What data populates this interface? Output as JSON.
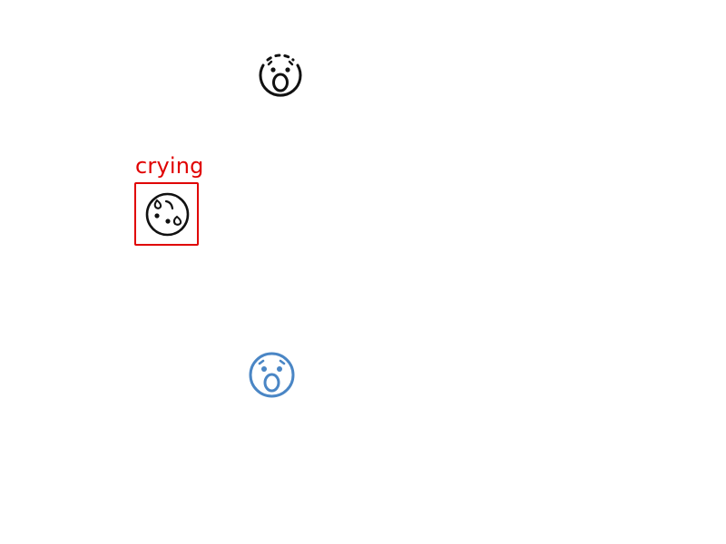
{
  "highlight": {
    "label": "crying",
    "color": "#e00000"
  },
  "icons": [
    {
      "name": "astonished-face-icon",
      "color": "#111111"
    },
    {
      "name": "crying-face-icon",
      "color": "#111111"
    },
    {
      "name": "astonished-face-icon",
      "color": "#4a86c5"
    }
  ]
}
